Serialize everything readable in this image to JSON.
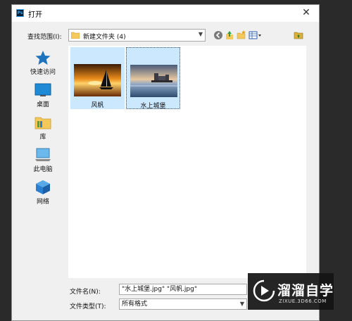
{
  "window": {
    "title": "打开",
    "app_badge": "Ps",
    "close_glyph": "✕"
  },
  "lookin": {
    "label": "查找范围(I):",
    "value": "新建文件夹 (4)"
  },
  "toolbar": {
    "back_icon": "back-icon",
    "up_icon": "up-folder-icon",
    "new_folder_icon": "new-folder-icon",
    "view_icon": "view-menu-icon",
    "extra_icon": "folder-action-icon"
  },
  "places": [
    {
      "label": "快速访问",
      "icon": "star-icon"
    },
    {
      "label": "桌面",
      "icon": "desktop-icon"
    },
    {
      "label": "库",
      "icon": "library-icon"
    },
    {
      "label": "此电脑",
      "icon": "computer-icon"
    },
    {
      "label": "网络",
      "icon": "network-icon"
    }
  ],
  "files": [
    {
      "name": "风帆"
    },
    {
      "name": "水上城堡"
    }
  ],
  "filename": {
    "label": "文件名(N):",
    "value": "\"水上城堡.jpg\" \"风帆.jpg\""
  },
  "filetype": {
    "label": "文件类型(T):",
    "value": "所有格式"
  },
  "watermark": {
    "brand": "溜溜自学",
    "url": "ZIXUE.3D66.COM"
  },
  "colors": {
    "selection": "#cce8ff",
    "accent": "#1e73be",
    "dialog_bg": "#f0f0f0"
  }
}
